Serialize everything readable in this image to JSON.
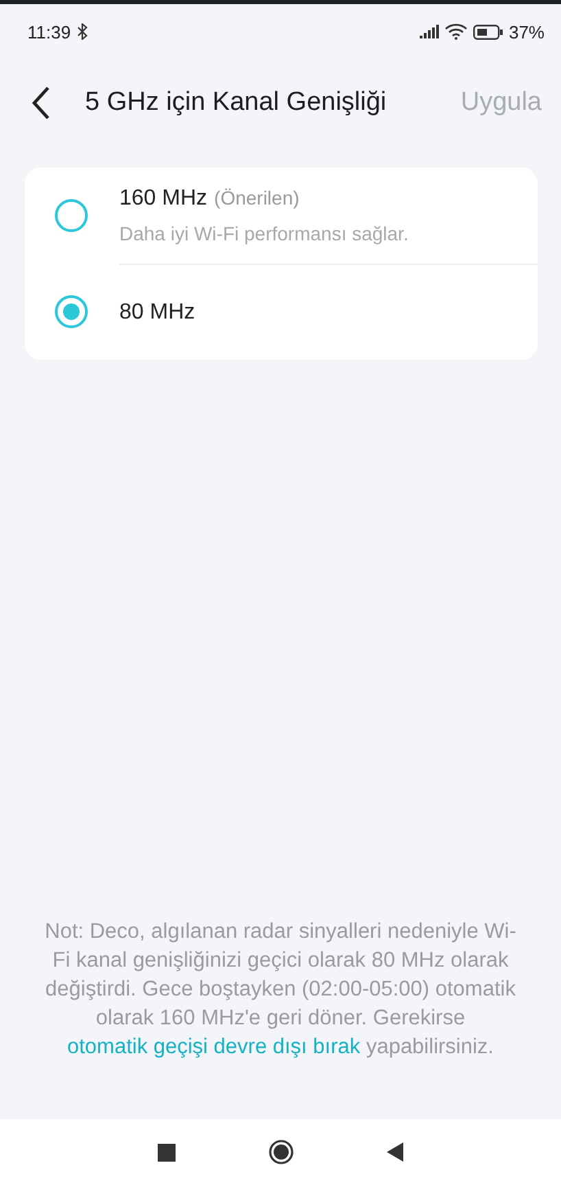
{
  "status_bar": {
    "time": "11:39",
    "battery": "37%"
  },
  "header": {
    "title": "5 GHz için Kanal Genişliği",
    "action": {
      "label": "Uygula",
      "disabled": true
    }
  },
  "options": [
    {
      "label": "160 MHz",
      "tag": "(Önerilen)",
      "description": "Daha iyi Wi-Fi performansı sağlar.",
      "selected": false
    },
    {
      "label": "80 MHz",
      "selected": true
    }
  ],
  "note": {
    "before": "Not: Deco, algılanan radar sinyalleri nedeniyle Wi-Fi kanal genişliğinizi geçici olarak 80 MHz olarak değiştirdi. Gece boştayken (02:00-05:00) otomatik olarak 160 MHz'e geri döner. Gerekirse ",
    "link": "otomatik geçişi devre dışı bırak",
    "after": " yapabilirsiniz."
  }
}
